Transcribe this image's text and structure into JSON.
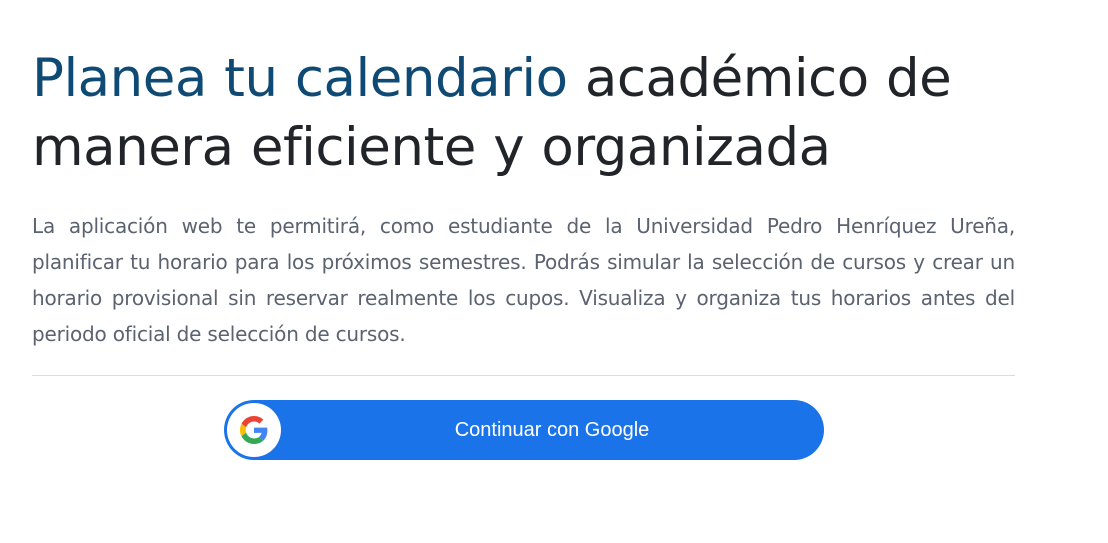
{
  "hero": {
    "title_accent": "Planea tu calendario",
    "title_rest": " académico de manera eficiente y organizada",
    "description": "La aplicación web te permitirá, como estudiante de la Universidad Pedro Henríquez Ureña, planificar tu horario para los próximos semestres. Podrás simular la selección de cursos y crear un horario provisional sin reservar realmente los cupos. Visualiza y organiza tus horarios antes del periodo oficial de selección de cursos."
  },
  "login": {
    "google_button_label": "Continuar con Google",
    "icon": "google-icon"
  },
  "colors": {
    "accent": "#0f4a75",
    "heading": "#212529",
    "body_text": "#5b6270",
    "button": "#1a73e8"
  }
}
